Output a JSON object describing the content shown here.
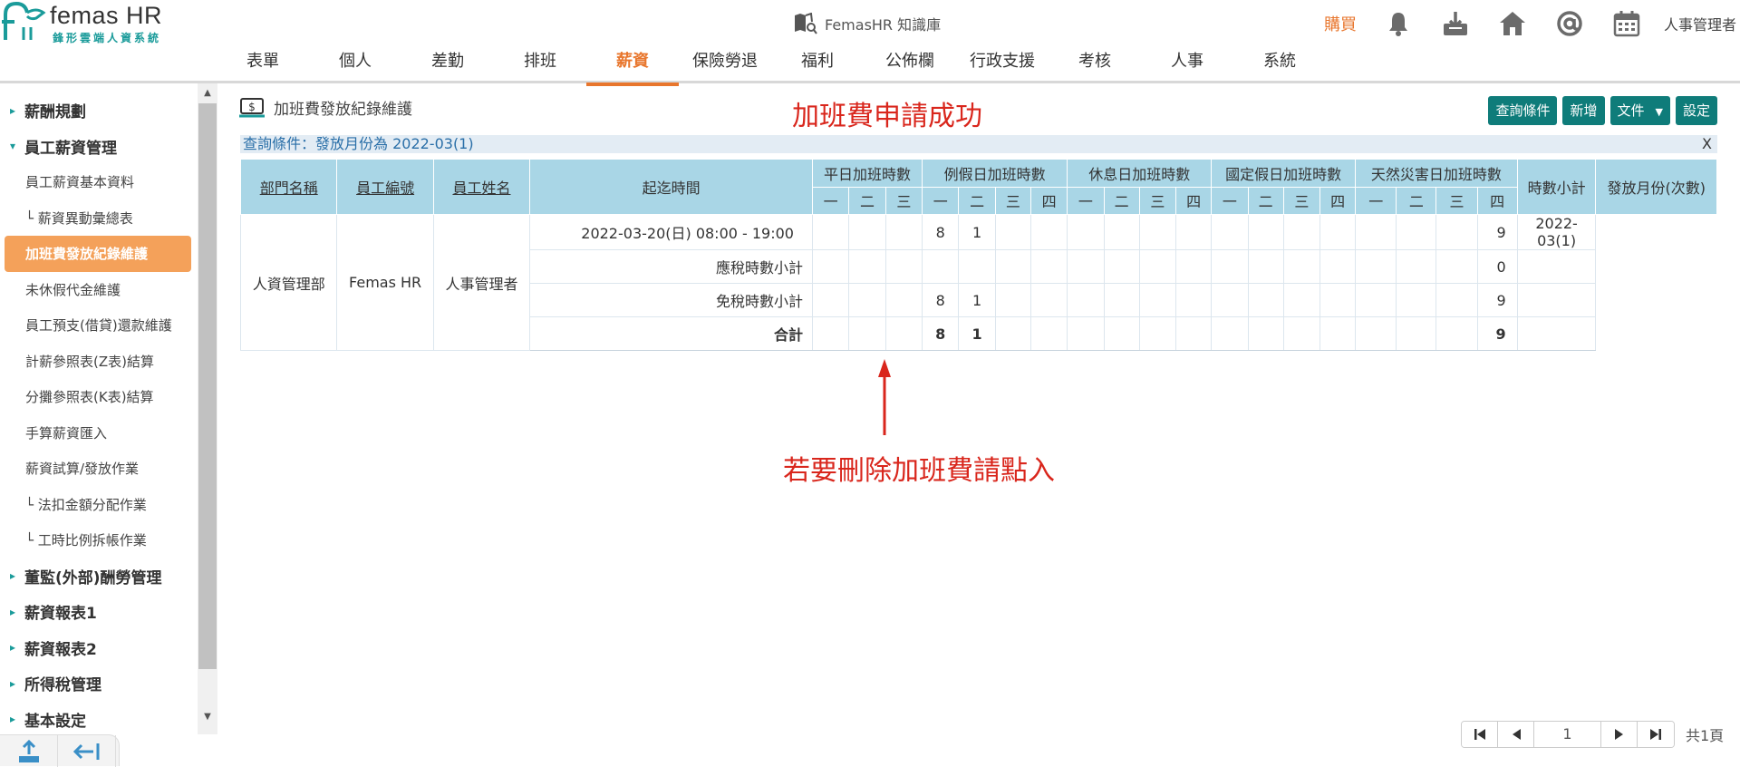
{
  "brand": {
    "title": "femas HR",
    "subtitle": "鋒形雲端人資系統"
  },
  "header": {
    "knowledge_base": "FemasHR 知識庫",
    "buy": "購買",
    "user": "人事管理者",
    "icons": [
      "bell-icon",
      "download-icon",
      "home-icon",
      "at-icon",
      "calendar-icon"
    ]
  },
  "nav": [
    "表單",
    "個人",
    "差勤",
    "排班",
    "薪資",
    "保險勞退",
    "福利",
    "公佈欄",
    "行政支援",
    "考核",
    "人事",
    "系統"
  ],
  "nav_active": "薪資",
  "sidebar": {
    "items": [
      {
        "label": "薪酬規劃",
        "level": "top",
        "caret": "▸"
      },
      {
        "label": "員工薪資管理",
        "level": "top",
        "caret": "▾"
      },
      {
        "label": "員工薪資基本資料",
        "level": "sub"
      },
      {
        "label": "└ 薪資異動彙總表",
        "level": "sub"
      },
      {
        "label": "加班費發放紀錄維護",
        "level": "sub",
        "active": true
      },
      {
        "label": "未休假代金維護",
        "level": "sub"
      },
      {
        "label": "員工預支(借貸)還款維護",
        "level": "sub"
      },
      {
        "label": "計薪參照表(Z表)結算",
        "level": "sub"
      },
      {
        "label": "分攤參照表(K表)結算",
        "level": "sub"
      },
      {
        "label": "手算薪資匯入",
        "level": "sub"
      },
      {
        "label": "薪資試算/發放作業",
        "level": "sub"
      },
      {
        "label": "└ 法扣金額分配作業",
        "level": "sub"
      },
      {
        "label": "└ 工時比例拆帳作業",
        "level": "sub"
      },
      {
        "label": "董監(外部)酬勞管理",
        "level": "top",
        "caret": "▸"
      },
      {
        "label": "薪資報表1",
        "level": "top",
        "caret": "▸"
      },
      {
        "label": "薪資報表2",
        "level": "top",
        "caret": "▸"
      },
      {
        "label": "所得稅管理",
        "level": "top",
        "caret": "▸"
      },
      {
        "label": "基本設定",
        "level": "top",
        "caret": "▸"
      }
    ]
  },
  "main": {
    "page_title": "加班費發放紀錄維護",
    "success_note": "加班費申請成功",
    "toolbar": {
      "query": "查詢條件",
      "add": "新增",
      "doc": "文件",
      "settings": "設定"
    },
    "query_text": "查詢條件：發放月份為 2022-03(1)",
    "query_close": "X",
    "delete_note": "若要刪除加班費請點入"
  },
  "table": {
    "headers": {
      "dept": "部門名稱",
      "emp_no": "員工編號",
      "emp_name": "員工姓名",
      "period": "起迄時間",
      "weekday": "平日加班時數",
      "rest": "例假日加班時數",
      "off": "休息日加班時數",
      "national": "國定假日加班時數",
      "disaster": "天然災害日加班時數",
      "subtotal": "時數小計",
      "month": "發放月份(次數)"
    },
    "sub_headers": [
      "一",
      "二",
      "三",
      "四"
    ],
    "employee": {
      "dept": "人資管理部",
      "emp_no": "Femas HR",
      "emp_name": "人事管理者"
    },
    "rows": [
      {
        "period": "2022-03-20(日) 08:00 - 19:00",
        "cells": [
          "",
          "",
          "",
          "8",
          "1",
          "",
          "",
          "",
          "",
          "",
          "",
          "",
          "",
          "",
          "",
          "",
          "",
          ""
        ],
        "subtotal": "9",
        "month": "2022-03(1)"
      },
      {
        "period": "應稅時數小計",
        "cells": [
          "",
          "",
          "",
          "",
          "",
          "",
          "",
          "",
          "",
          "",
          "",
          "",
          "",
          "",
          "",
          "",
          "",
          ""
        ],
        "subtotal": "0",
        "month": ""
      },
      {
        "period": "免稅時數小計",
        "cells": [
          "",
          "",
          "",
          "8",
          "1",
          "",
          "",
          "",
          "",
          "",
          "",
          "",
          "",
          "",
          "",
          "",
          "",
          ""
        ],
        "subtotal": "9",
        "month": ""
      },
      {
        "period": "合計",
        "cells": [
          "",
          "",
          "",
          "8",
          "1",
          "",
          "",
          "",
          "",
          "",
          "",
          "",
          "",
          "",
          "",
          "",
          "",
          ""
        ],
        "subtotal": "9",
        "month": "",
        "bold": true
      }
    ]
  },
  "pager": {
    "current": "1",
    "total": "共1頁"
  }
}
